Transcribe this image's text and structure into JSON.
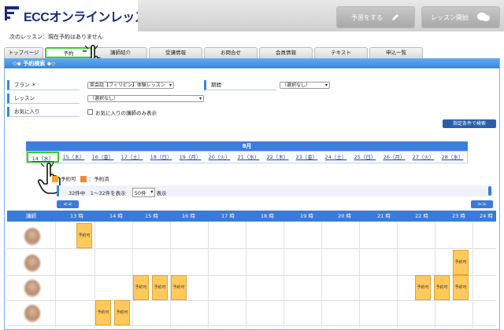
{
  "header": {
    "logo_text": "ECCオンラインレッスン",
    "reserve_button": "予習をする",
    "lesson_start_button": "レッスン開始"
  },
  "next_lesson": "次のレッスン：現在予約はありません",
  "tabs": [
    "トップページ",
    "予約",
    "講師紹介",
    "受講情報",
    "お問合せ",
    "会員情報",
    "テキスト",
    "申込一覧"
  ],
  "panel_title": "◇◆ 予約検索 ◆◇",
  "form": {
    "plan_label": "プラン ＊",
    "plan_value": "英会話【フィリピン】体験レッスン",
    "period_label": "期間",
    "period_value": "（選択なし）",
    "lesson_label": "レッスン",
    "lesson_value": "（選択なし）",
    "favorite_label": "お気に入り",
    "favorite_checkbox": "お気に入りの講師のみ表示",
    "search_button": "指定条件で検索"
  },
  "calendar": {
    "month": "8月",
    "days": [
      "14（水）",
      "15（木）",
      "16（金）",
      "17（土）",
      "18（日）",
      "19（月）",
      "20（火）",
      "21（水）",
      "22（木）",
      "23（金）",
      "24（土）",
      "25（日）",
      "26（月）",
      "27（火）",
      "28（水）"
    ]
  },
  "legend": {
    "available": "予約可",
    "booked": "：予約済"
  },
  "results": {
    "count_text": "32件中　1〜32件を表示",
    "per_page": "50件",
    "show_label": "表示"
  },
  "nav": {
    "prev": "<<",
    "next": ">>"
  },
  "grid": {
    "col_label": "講師",
    "hours": [
      "13 時",
      "14 時",
      "15 時",
      "16 時",
      "17 時",
      "18 時",
      "19 時",
      "20 時",
      "21 時",
      "22 時",
      "23 時",
      "24 時"
    ],
    "slot_label": "予約可"
  }
}
